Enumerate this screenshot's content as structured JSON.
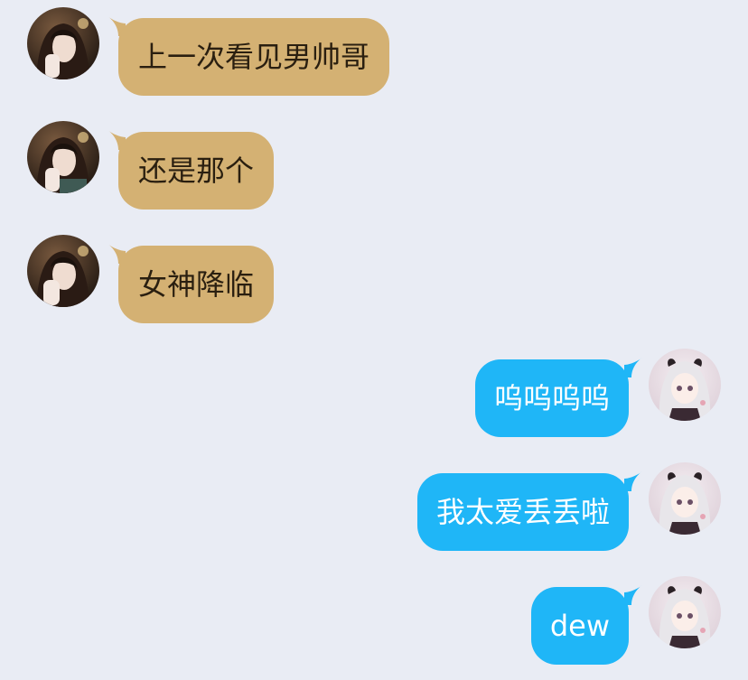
{
  "colors": {
    "background": "#e9ecf4",
    "incoming_bubble": "#d4b173",
    "incoming_text": "#2a1f10",
    "outgoing_bubble": "#1fb6f7",
    "outgoing_text": "#ffffff"
  },
  "messages": [
    {
      "direction": "incoming",
      "text": "上一次看见男帅哥",
      "avatar_icon": "dark-hair-girl-avatar"
    },
    {
      "direction": "incoming",
      "text": "还是那个",
      "avatar_icon": "dark-hair-girl-avatar"
    },
    {
      "direction": "incoming",
      "text": "女神降临",
      "avatar_icon": "dark-hair-girl-avatar"
    },
    {
      "direction": "outgoing",
      "text": "呜呜呜呜",
      "avatar_icon": "anime-girl-avatar"
    },
    {
      "direction": "outgoing",
      "text": "我太爱丢丢啦",
      "avatar_icon": "anime-girl-avatar"
    },
    {
      "direction": "outgoing",
      "text": "dew",
      "avatar_icon": "anime-girl-avatar"
    }
  ]
}
